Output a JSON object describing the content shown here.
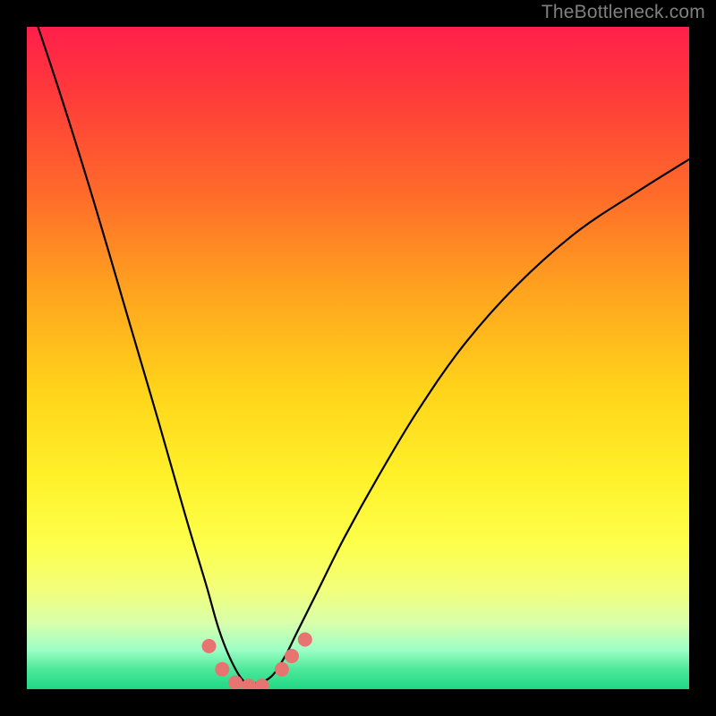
{
  "watermark": "TheBottleneck.com",
  "chart_data": {
    "type": "line",
    "title": "",
    "xlabel": "",
    "ylabel": "",
    "xlim": [
      0,
      1
    ],
    "ylim": [
      0,
      1
    ],
    "series": [
      {
        "name": "bottleneck-curve",
        "description": "V-shaped bottleneck curve plotted over red-to-green vertical gradient; valley near x≈0.34 reaching y≈0 (green=optimal), rising toward y≈1 (red=severe bottleneck) at both ends.",
        "x": [
          0.0,
          0.05,
          0.1,
          0.15,
          0.2,
          0.24,
          0.27,
          0.29,
          0.31,
          0.33,
          0.35,
          0.37,
          0.39,
          0.41,
          0.44,
          0.48,
          0.53,
          0.59,
          0.66,
          0.74,
          0.83,
          0.92,
          1.0
        ],
        "y": [
          1.05,
          0.9,
          0.74,
          0.57,
          0.4,
          0.26,
          0.16,
          0.09,
          0.04,
          0.01,
          0.01,
          0.02,
          0.05,
          0.09,
          0.15,
          0.23,
          0.32,
          0.42,
          0.52,
          0.61,
          0.69,
          0.75,
          0.8
        ]
      }
    ],
    "markers": {
      "name": "valley-dots",
      "color": "#e77470",
      "x": [
        0.275,
        0.295,
        0.315,
        0.335,
        0.355,
        0.385,
        0.4,
        0.42
      ],
      "y": [
        0.065,
        0.03,
        0.01,
        0.005,
        0.005,
        0.03,
        0.05,
        0.075
      ]
    },
    "gradient_stops": [
      {
        "pos": 0.0,
        "color": "#ff1f4b"
      },
      {
        "pos": 0.1,
        "color": "#ff3a3a"
      },
      {
        "pos": 0.25,
        "color": "#ff6a2a"
      },
      {
        "pos": 0.4,
        "color": "#ffa41e"
      },
      {
        "pos": 0.55,
        "color": "#ffd41a"
      },
      {
        "pos": 0.68,
        "color": "#fff12a"
      },
      {
        "pos": 0.78,
        "color": "#fdff4a"
      },
      {
        "pos": 0.85,
        "color": "#f2ff7a"
      },
      {
        "pos": 0.9,
        "color": "#d8ffab"
      },
      {
        "pos": 0.94,
        "color": "#9effc6"
      },
      {
        "pos": 0.97,
        "color": "#4de89a"
      },
      {
        "pos": 1.0,
        "color": "#1fd884"
      }
    ]
  }
}
